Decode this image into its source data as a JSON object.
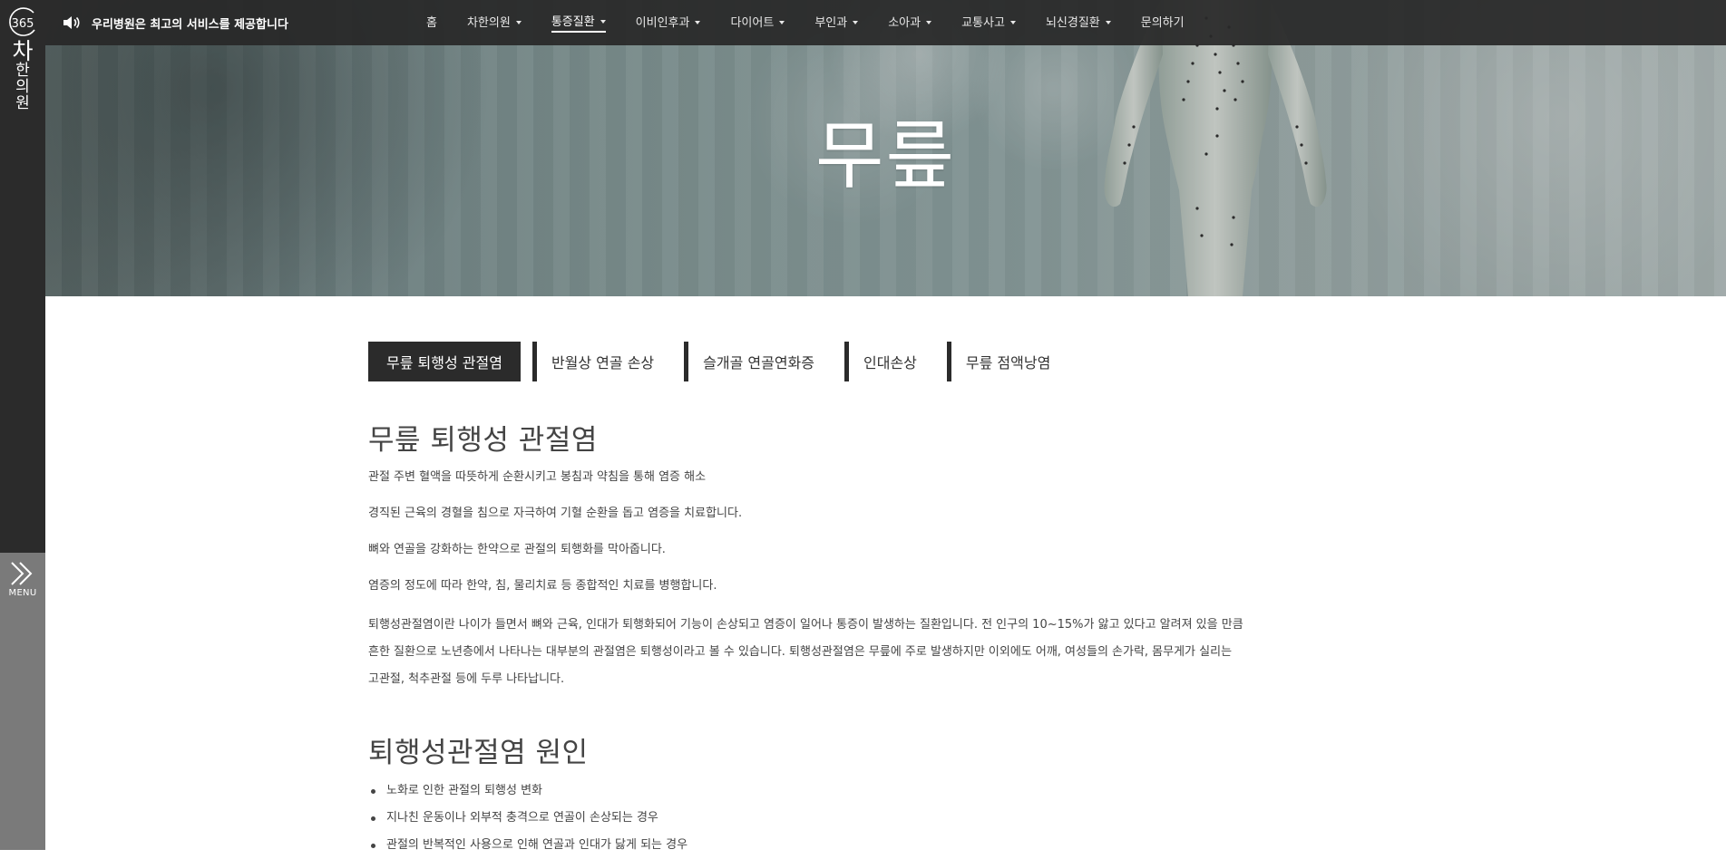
{
  "brand": {
    "logo_number": "365",
    "logo_char_big": "차",
    "logo_chars_small": [
      "한",
      "의",
      "원"
    ]
  },
  "topbar": {
    "announcement": "우리병원은 최고의 서비스를 제공합니다",
    "nav": [
      {
        "label": "홈",
        "dropdown": false,
        "active": false
      },
      {
        "label": "차한의원",
        "dropdown": true,
        "active": false
      },
      {
        "label": "통증질환",
        "dropdown": true,
        "active": true
      },
      {
        "label": "이비인후과",
        "dropdown": true,
        "active": false
      },
      {
        "label": "다이어트",
        "dropdown": true,
        "active": false
      },
      {
        "label": "부인과",
        "dropdown": true,
        "active": false
      },
      {
        "label": "소아과",
        "dropdown": true,
        "active": false
      },
      {
        "label": "교통사고",
        "dropdown": true,
        "active": false
      },
      {
        "label": "뇌신경질환",
        "dropdown": true,
        "active": false
      },
      {
        "label": "문의하기",
        "dropdown": false,
        "active": false
      }
    ]
  },
  "sidebar": {
    "menu_label": "MENU"
  },
  "hero": {
    "title": "무릎"
  },
  "tabs": [
    {
      "label": "무릎 퇴행성 관절염",
      "active": true
    },
    {
      "label": "반월상 연골 손상",
      "active": false
    },
    {
      "label": "슬개골 연골연화증",
      "active": false
    },
    {
      "label": "인대손상",
      "active": false
    },
    {
      "label": "무릎 점액낭염",
      "active": false
    }
  ],
  "content": {
    "section1_title": "무릎 퇴행성 관절염",
    "paragraphs": [
      "관절 주변 혈액을 따뜻하게 순환시키고 봉침과 약침을 통해 염증 해소",
      "경직된 근육의 경혈을 침으로 자극하여 기혈 순환을 돕고 염증을 치료합니다.",
      "뼈와 연골을 강화하는 한약으로 관절의 퇴행화를 막아줍니다.",
      "염증의 정도에 따라 한약, 침, 물리치료 등 종합적인 치료를 병행합니다."
    ],
    "long_paragraph_lines": [
      "퇴행성관절염이란 나이가 들면서 뼈와 근육, 인대가 퇴행화되어 기능이 손상되고 염증이 일어나 통증이 발생하는 질환입니다. 전 인구의 10~15%가 앓고 있다고 알려져 있을 만큼",
      "흔한 질환으로 노년층에서 나타나는 대부분의 관절염은 퇴행성이라고 볼 수 있습니다. 퇴행성관절염은 무릎에 주로 발생하지만 이외에도 어깨, 여성들의 손가락, 몸무게가 실리는",
      "고관절, 척추관절 등에 두루 나타납니다."
    ],
    "section2_title": "퇴행성관절염 원인",
    "causes": [
      "노화로 인한 관절의 퇴행성 변화",
      "지나친 운동이나 외부적 충격으로 연골이 손상되는 경우",
      "관절의 반복적인 사용으로 인해 연골과 인대가 닳게 되는 경우"
    ]
  },
  "colors": {
    "sidebar_dark": "#2b2b2b",
    "sidebar_light": "#7a7a7a",
    "topbar": "#282828",
    "active_tab_bg": "#2b2b2b",
    "text": "#444444"
  },
  "icons": {
    "announcement": "speaker-icon",
    "menu": "double-chevron-right-icon",
    "nav_dropdown": "caret-down-icon"
  }
}
